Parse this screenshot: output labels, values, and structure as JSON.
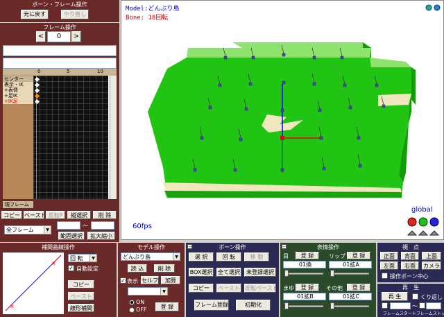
{
  "bone_frame_panel": {
    "title": "ボーン・フレーム操作",
    "undo": "元に戻す",
    "redo": "やり直し"
  },
  "frame_panel": {
    "title": "フレーム操作",
    "prev": "<",
    "frame_value": "0",
    "next": ">",
    "timeline_ticks": [
      "0",
      "5",
      "10"
    ],
    "rows": [
      "センター",
      "表示・IK",
      "+表情",
      "+足IK",
      "+IK足"
    ],
    "current_frame_label": "現フレーム",
    "copy": "コピー",
    "paste": "ペースト",
    "reverse_paste": "反転P",
    "vertical_select": "縦選択",
    "delete": "削 除",
    "frame_select": "全フレーム",
    "tilde": "〜",
    "range_select": "範囲選択",
    "zoom": "拡大縮小"
  },
  "viewport": {
    "model_label": "Model:どんぶり島",
    "bone_label": "Bone: 18回転",
    "fps": "60fps",
    "global_label": "global"
  },
  "interp_panel": {
    "title": "補間曲線操作",
    "rotation_select": "回 転",
    "auto_set_label": "自動設定",
    "copy": "コピー",
    "paste": "ペースト",
    "linear": "線形補間"
  },
  "model_panel": {
    "title": "モデル操作",
    "model_select": "どんぶり島",
    "load": "読 込",
    "delete": "削 除",
    "show_label": "表示",
    "self_shadow": "セルフ影",
    "add": "加算",
    "on_label": "ON",
    "off_label": "OFF",
    "register": "登 録"
  },
  "bone_panel": {
    "title": "ボーン操作",
    "select": "選 択",
    "rotate": "回 転",
    "move": "移 動",
    "box_select": "BOX選択",
    "select_all": "全て選択",
    "unregistered": "未登録選択",
    "copy": "コピー",
    "paste": "ペースト",
    "reverse_paste": "反転ペースト",
    "frame_register": "フレーム登録",
    "reset": "初期化"
  },
  "face_panel": {
    "title": "表情操作",
    "eye_label": "目",
    "lip_label": "リップ",
    "brow_label": "まゆ",
    "other_label": "その他",
    "register": "登 録",
    "eye_select": "01換",
    "lip_select": "01拡A",
    "brow_select": "01拡B",
    "other_select": "01拡C"
  },
  "view_panel": {
    "title": "視　点",
    "front": "正面",
    "back": "背面",
    "top": "上面",
    "left": "左面",
    "right": "右面",
    "camera": "カメラ",
    "bone_center_label": "操作ボーン中心",
    "play_title": "再　生",
    "play": "再 生",
    "repeat_label": "くり返し",
    "frame_start": "フレームスタート",
    "frame_stop": "フレームストップ"
  },
  "colors": {
    "panel_bg": "#6a2a2a",
    "viewport_bg": "#ffffff",
    "terrain_green": "#22c414",
    "sand": "#f1e7bf"
  }
}
